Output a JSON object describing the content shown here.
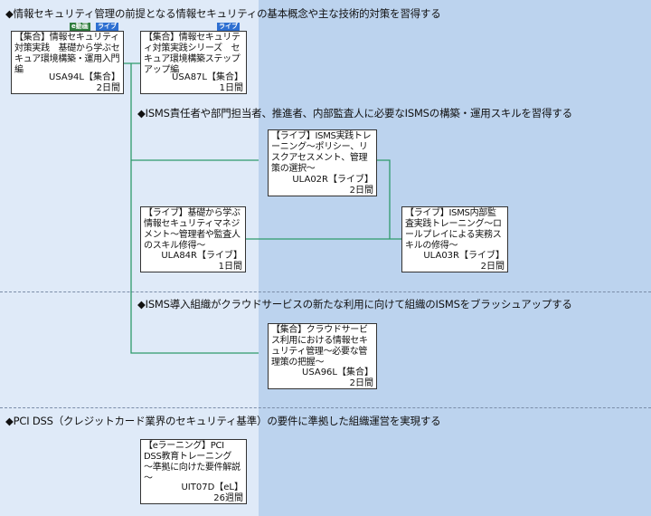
{
  "colors": {
    "line": "#2e9a6c",
    "badge_video": "#2f7d3e",
    "badge_live": "#2d6fd1"
  },
  "sections": [
    {
      "heading": "◆情報セキュリティ管理の前提となる情報セキュリティの基本概念や主な技術的対策を習得する"
    },
    {
      "heading": "◆ISMS責任者や部門担当者、推進者、内部監査人に必要なISMSの構築・運用スキルを習得する"
    },
    {
      "heading": "◆ISMS導入組織がクラウドサービスの新たな利用に向けて組織のISMSをブラッシュアップする"
    },
    {
      "heading": "◆PCI DSS（クレジットカード業界のセキュリティ基準）の要件に準拠した組織運営を実現する"
    }
  ],
  "courses": {
    "usa94l": {
      "title": "【集合】情報セキュリティ対策実践　基礎から学ぶセキュア環境構築・運用入門編",
      "code": "USA94L【集合】",
      "duration": "2日間",
      "badges": [
        "e動画",
        "ライブ"
      ]
    },
    "usa87l": {
      "title": "【集合】情報セキュリティ対策実践シリーズ　セキュア環境構築ステップアップ編",
      "code": "USA87L【集合】",
      "duration": "1日間",
      "badges": [
        "ライブ"
      ]
    },
    "ula02r": {
      "title": "【ライブ】ISMS実践トレーニング～ポリシー、リスクアセスメント、管理策の選択～",
      "code": "ULA02R【ライブ】",
      "duration": "2日間"
    },
    "ula84r": {
      "title": "【ライブ】基礎から学ぶ情報セキュリティマネジメント～管理者や監査人のスキル修得～",
      "code": "ULA84R【ライブ】",
      "duration": "1日間"
    },
    "ula03r": {
      "title": "【ライブ】ISMS内部監査実践トレーニング～ロールプレイによる実務スキルの修得～",
      "code": "ULA03R【ライブ】",
      "duration": "2日間"
    },
    "usa96l": {
      "title": "【集合】クラウドサービス利用における情報セキュリティ管理～必要な管理策の把握～",
      "code": "USA96L【集合】",
      "duration": "2日間"
    },
    "uit07d": {
      "title": "【eラーニング】PCI DSS教育トレーニング　～準拠に向けた要件解説～",
      "code": "UIT07D【eL】",
      "duration": "26週間"
    }
  }
}
